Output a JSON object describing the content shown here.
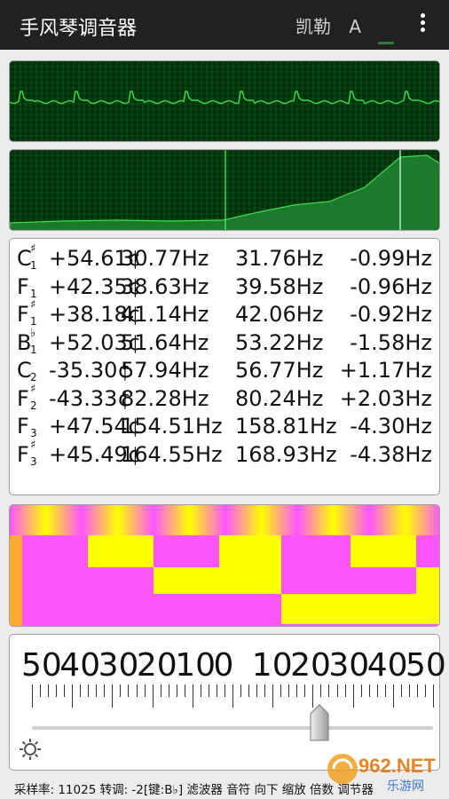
{
  "header": {
    "title": "手风琴调音器",
    "temperament": "凯勒",
    "pitch_label": "A",
    "menu_icon": "more-vert-icon"
  },
  "notes": [
    {
      "letter": "C",
      "accidental": "♯",
      "octave": "1",
      "cents": "+54.61¢",
      "freq": "30.77Hz",
      "target": "31.76Hz",
      "diff": "-0.99Hz"
    },
    {
      "letter": "F",
      "accidental": "",
      "octave": "1",
      "cents": "+42.35¢",
      "freq": "38.63Hz",
      "target": "39.58Hz",
      "diff": "-0.96Hz"
    },
    {
      "letter": "F",
      "accidental": "♯",
      "octave": "1",
      "cents": "+38.18¢",
      "freq": "41.14Hz",
      "target": "42.06Hz",
      "diff": "-0.92Hz"
    },
    {
      "letter": "B",
      "accidental": "♭",
      "octave": "1",
      "cents": "+52.03¢",
      "freq": "51.64Hz",
      "target": "53.22Hz",
      "diff": "-1.58Hz"
    },
    {
      "letter": "C",
      "accidental": "",
      "octave": "2",
      "cents": "-35.30¢",
      "freq": "57.94Hz",
      "target": "56.77Hz",
      "diff": "+1.17Hz"
    },
    {
      "letter": "F",
      "accidental": "♯",
      "octave": "2",
      "cents": "-43.33¢",
      "freq": "82.28Hz",
      "target": "80.24Hz",
      "diff": "+2.03Hz"
    },
    {
      "letter": "F",
      "accidental": "",
      "octave": "3",
      "cents": "+47.54¢",
      "freq": "154.51Hz",
      "target": "158.81Hz",
      "diff": "-4.30Hz"
    },
    {
      "letter": "F",
      "accidental": "♯",
      "octave": "3",
      "cents": "+45.49¢",
      "freq": "164.55Hz",
      "target": "168.93Hz",
      "diff": "-4.38Hz"
    }
  ],
  "meter": {
    "scale": [
      "50",
      "40",
      "30",
      "20",
      "10",
      "0",
      "10",
      "20",
      "30",
      "40",
      "50"
    ],
    "settings_icon": "gear-icon"
  },
  "status": {
    "text": "采样率: 11025  转调: -2[键:B♭]  滤波器 音符 向下 缩放 倍数 调节器"
  },
  "watermark": {
    "text": "962.NET",
    "subtext": "乐游网"
  },
  "colors": {
    "scope_bg": "#00300a",
    "scope_line": "#3ddc4a",
    "heatmap_magenta": "#ff55ff",
    "heatmap_yellow": "#ffff00",
    "topbar": "#212121"
  }
}
